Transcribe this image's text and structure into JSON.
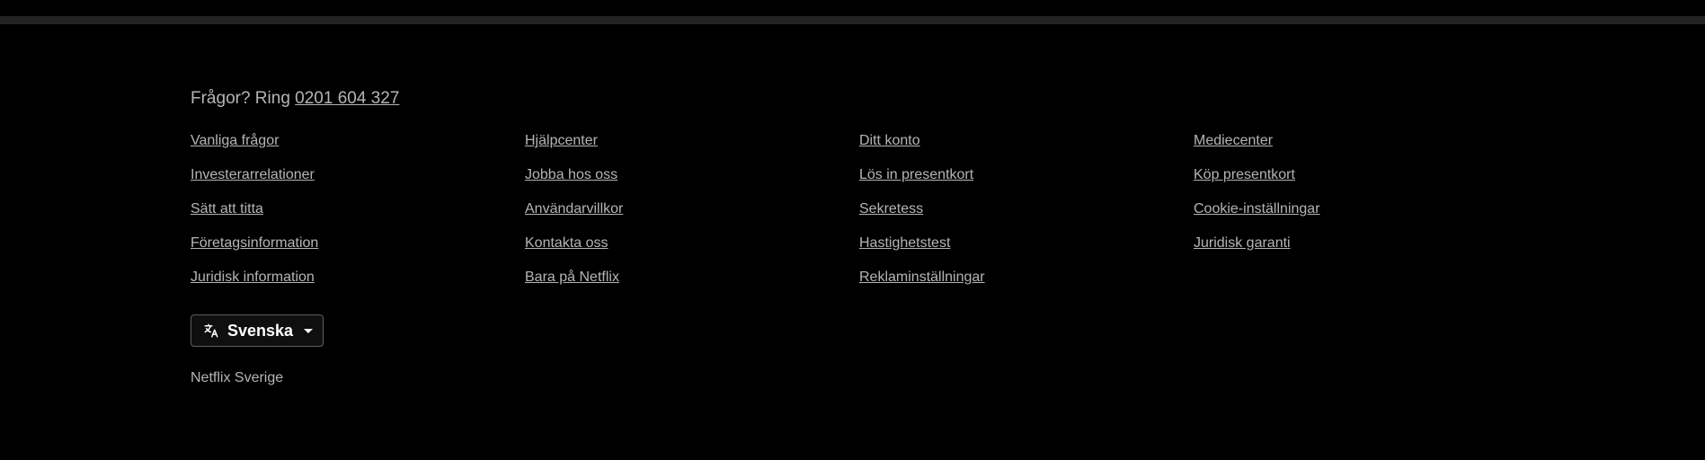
{
  "footer": {
    "questions_prefix": "Frågor? Ring ",
    "phone": "0201 604 327",
    "columns": [
      [
        "Vanliga frågor",
        "Investerarrelationer",
        "Sätt att titta",
        "Företagsinformation",
        "Juridisk information"
      ],
      [
        "Hjälpcenter",
        "Jobba hos oss",
        "Användarvillkor",
        "Kontakta oss",
        "Bara på Netflix"
      ],
      [
        "Ditt konto",
        "Lös in presentkort",
        "Sekretess",
        "Hastighetstest",
        "Reklaminställningar"
      ],
      [
        "Mediecenter",
        "Köp presentkort",
        "Cookie-inställningar",
        "Juridisk garanti"
      ]
    ],
    "language": {
      "selected": "Svenska",
      "icon": "translate-icon"
    },
    "country": "Netflix Sverige"
  }
}
